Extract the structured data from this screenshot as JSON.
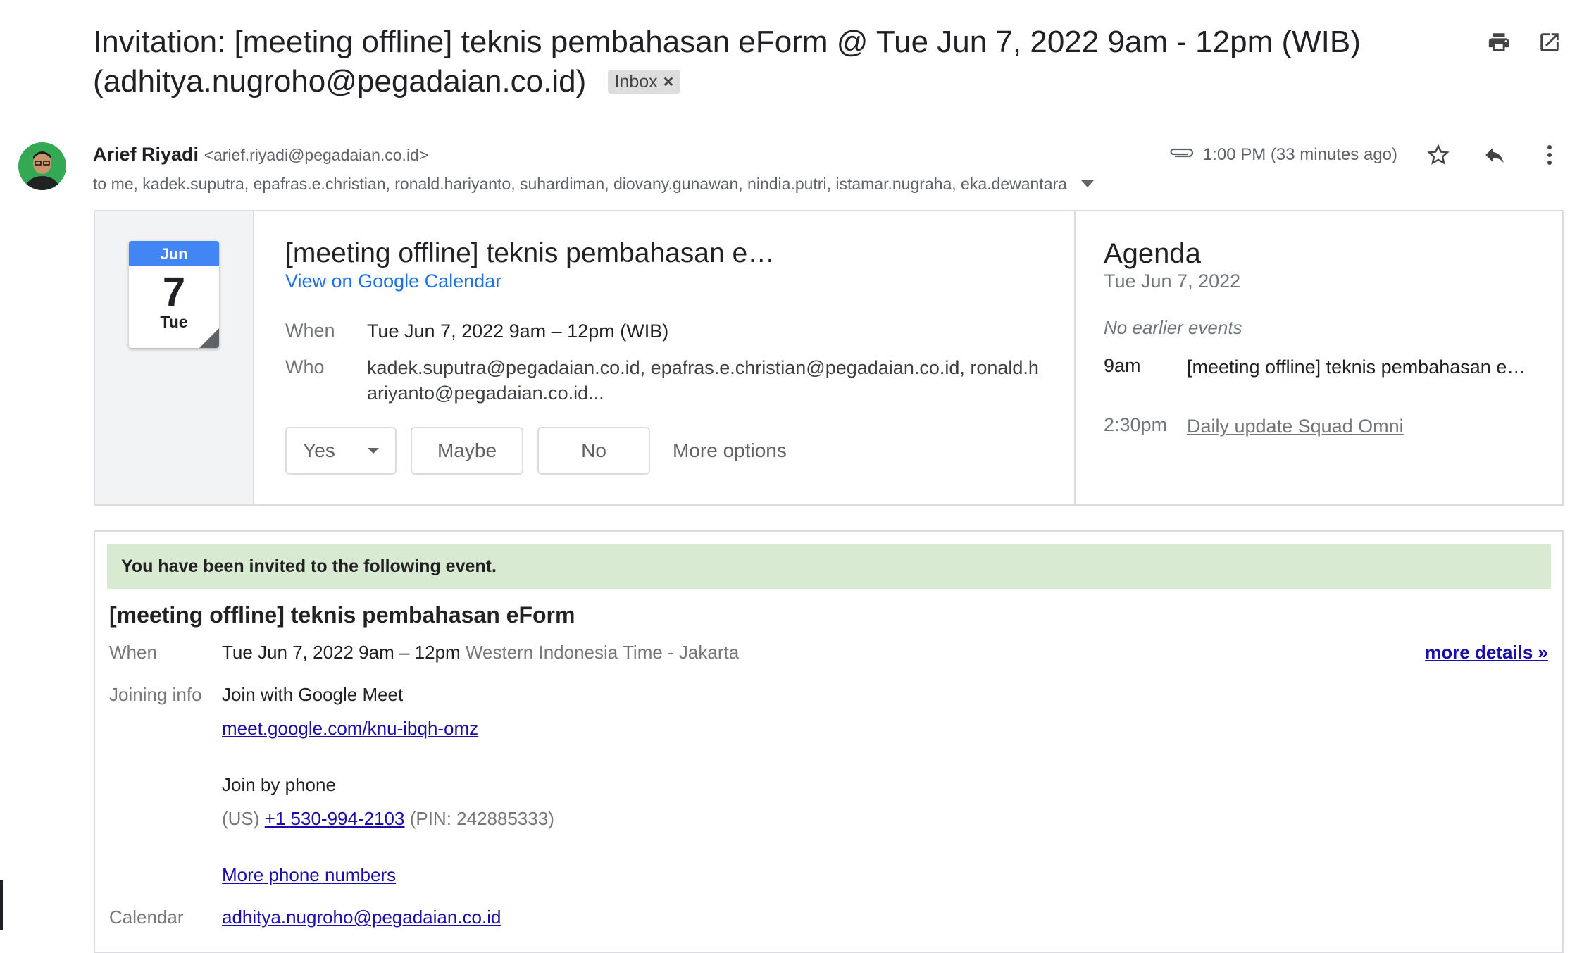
{
  "subject": {
    "text": "Invitation: [meeting offline] teknis pembahasan eForm @ Tue Jun 7, 2022 9am - 12pm (WIB) (adhitya.nugroho@pegadaian.co.id)",
    "label_chip": "Inbox",
    "label_remove": "×"
  },
  "toolbar": {
    "print_icon": "print-icon",
    "popout_icon": "open-in-new-window-icon"
  },
  "sender": {
    "name": "Arief Riyadi",
    "email": "<arief.riyadi@pegadaian.co.id>",
    "recipients": "to me, kadek.suputra, epafras.e.christian, ronald.hariyanto, suhardiman, diovany.gunawan, nindia.putri, istamar.nugraha, eka.dewantara"
  },
  "message_meta": {
    "time": "1:00 PM (33 minutes ago)",
    "icons": [
      "attachment-icon",
      "star-icon",
      "reply-icon",
      "more-vert-icon"
    ]
  },
  "invite_card": {
    "calendar_icon": {
      "month": "Jun",
      "day": "7",
      "weekday": "Tue"
    },
    "title": "[meeting offline] teknis pembahasan e…",
    "view_link": "View on Google Calendar",
    "when_label": "When",
    "when_value": "Tue Jun 7, 2022 9am – 12pm (WIB)",
    "who_label": "Who",
    "who_value": "kadek.suputra@pegadaian.co.id, epafras.e.christian@pegadaian.co.id, ronald.hariyanto@pegadaian.co.id...",
    "rsvp": {
      "yes": "Yes",
      "maybe": "Maybe",
      "no": "No",
      "more": "More options"
    }
  },
  "agenda": {
    "title": "Agenda",
    "date": "Tue Jun 7, 2022",
    "no_earlier": "No earlier events",
    "events": [
      {
        "time": "9am",
        "title": "[meeting offline] teknis pembahasan e…"
      },
      {
        "time": "2:30pm",
        "title": "Daily update Squad Omni"
      }
    ]
  },
  "email_body": {
    "banner": "You have been invited to the following event.",
    "title": "[meeting offline] teknis pembahasan eForm",
    "when_label": "When",
    "when_value": "Tue Jun 7, 2022 9am – 12pm",
    "when_tz": "Western Indonesia Time - Jakarta",
    "more_details": "more details »",
    "joining_label": "Joining info",
    "join_meet": "Join with Google Meet",
    "meet_link": "meet.google.com/knu-ibqh-omz",
    "join_phone": "Join by phone",
    "phone_prefix": "(US)",
    "phone_number": "+1 530-994-2103",
    "phone_pin": "(PIN: 242885333)",
    "more_numbers": "More phone numbers",
    "calendar_label": "Calendar",
    "calendar_value": "adhitya.nugroho@pegadaian.co.id"
  },
  "colors": {
    "accent_blue": "#1a73e8",
    "calendar_header": "#4285f4",
    "banner_green": "#d9ead3",
    "link": "#1a0dab"
  }
}
